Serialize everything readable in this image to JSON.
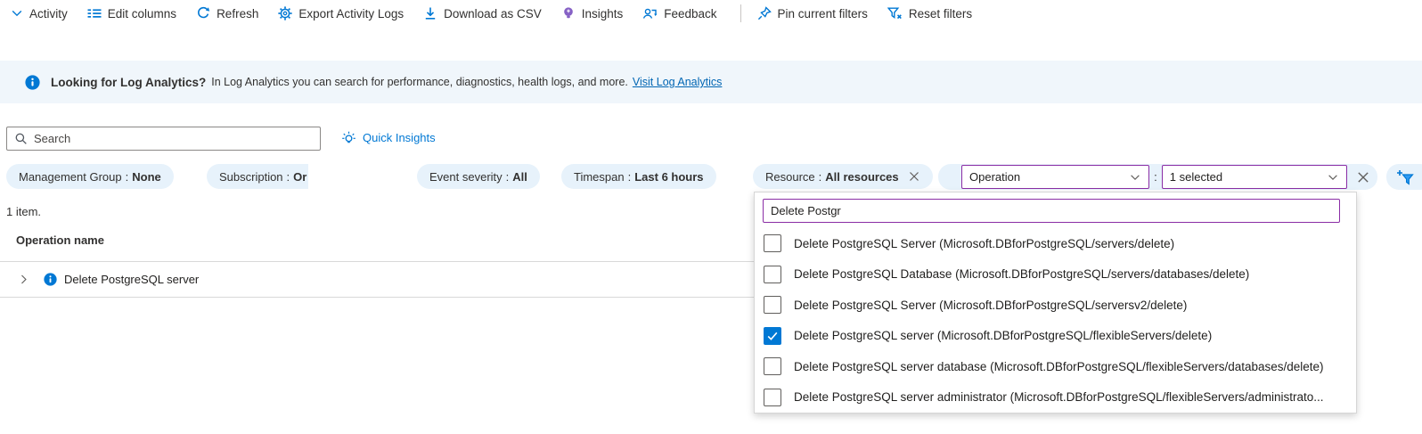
{
  "colors": {
    "accent": "#0078d4",
    "combo_border_purple": "#8a2da5",
    "pill_bg": "#e7f2fb",
    "banner_bg": "#f0f6fb",
    "insights_purple": "#8661c5"
  },
  "toolbar": {
    "items": [
      {
        "label": "Activity",
        "icon": "chevron-down-icon"
      },
      {
        "label": "Edit columns",
        "icon": "edit-columns-icon"
      },
      {
        "label": "Refresh",
        "icon": "refresh-icon"
      },
      {
        "label": "Export Activity Logs",
        "icon": "gear-icon"
      },
      {
        "label": "Download as CSV",
        "icon": "download-icon"
      },
      {
        "label": "Insights",
        "icon": "lightbulb-icon"
      },
      {
        "label": "Feedback",
        "icon": "feedback-icon"
      },
      {
        "label": "Pin current filters",
        "icon": "pin-icon"
      },
      {
        "label": "Reset filters",
        "icon": "reset-filters-icon"
      }
    ]
  },
  "banner": {
    "title": "Looking for Log Analytics?",
    "text": "In Log Analytics you can search for performance, diagnostics, health logs, and more.",
    "link": "Visit Log Analytics"
  },
  "search": {
    "placeholder": "Search"
  },
  "quick_insights": {
    "label": "Quick Insights"
  },
  "filters": {
    "separator": ":",
    "pills": [
      {
        "name": "Management Group",
        "value": "None"
      },
      {
        "name": "Subscription",
        "value": "Or"
      },
      {
        "name": "Event severity",
        "value": "All"
      },
      {
        "name": "Timespan",
        "value": "Last 6 hours"
      },
      {
        "name": "Resource",
        "value": "All resources"
      }
    ],
    "operation_filter": {
      "field": "Operation",
      "value": "1 selected"
    }
  },
  "results": {
    "count_text": "1 item.",
    "column_header": "Operation name",
    "rows": [
      {
        "name": "Delete PostgreSQL server"
      }
    ]
  },
  "operation_dropdown": {
    "search_value": "Delete Postgr",
    "options": [
      {
        "label": "Delete PostgreSQL Server (Microsoft.DBforPostgreSQL/servers/delete)",
        "checked": false
      },
      {
        "label": "Delete PostgreSQL Database (Microsoft.DBforPostgreSQL/servers/databases/delete)",
        "checked": false
      },
      {
        "label": "Delete PostgreSQL Server (Microsoft.DBforPostgreSQL/serversv2/delete)",
        "checked": false
      },
      {
        "label": "Delete PostgreSQL server (Microsoft.DBforPostgreSQL/flexibleServers/delete)",
        "checked": true
      },
      {
        "label": "Delete PostgreSQL server database (Microsoft.DBforPostgreSQL/flexibleServers/databases/delete)",
        "checked": false
      },
      {
        "label": "Delete PostgreSQL server administrator (Microsoft.DBforPostgreSQL/flexibleServers/administrato...",
        "checked": false
      }
    ]
  }
}
